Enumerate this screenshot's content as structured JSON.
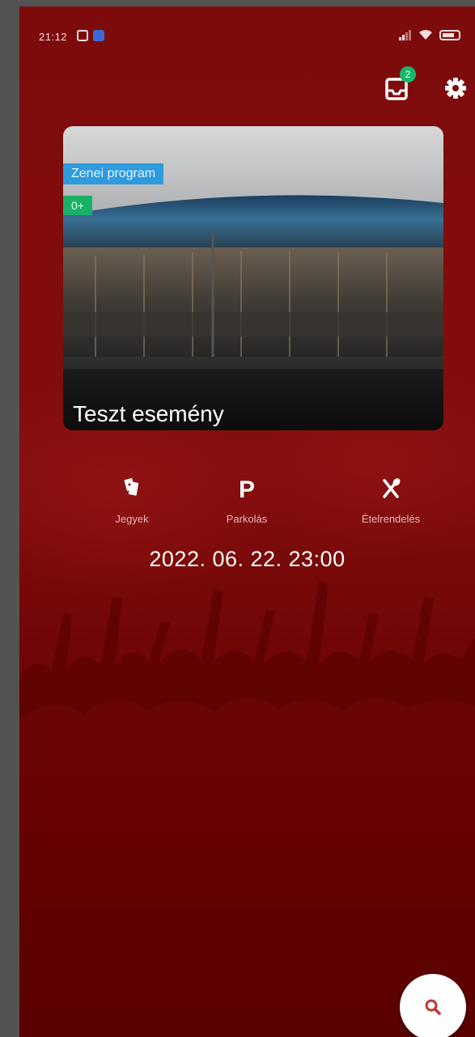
{
  "status_bar": {
    "time": "21:12",
    "icons": [
      "notification-icon",
      "app-icon",
      "signal-icon",
      "wifi-icon",
      "battery-icon"
    ]
  },
  "header": {
    "inbox_badge": "2",
    "inbox_icon": "inbox-icon",
    "settings_icon": "gear-icon"
  },
  "event_card": {
    "category": "Zenei program",
    "age_rating": "0+",
    "title": "Teszt esemény"
  },
  "quick_actions": [
    {
      "label": "Jegyek",
      "icon": "ticket-icon"
    },
    {
      "label": "Parkolás",
      "icon": "parking-icon"
    },
    {
      "label": "Ételrendelés",
      "icon": "food-icon"
    }
  ],
  "event_datetime": "2022. 06. 22. 23:00",
  "fab": {
    "icon": "search-icon"
  },
  "colors": {
    "background": "#7d0a0a",
    "category_tag": "#2e9bde",
    "age_tag": "#19b067",
    "badge": "#18b86a",
    "fab_icon": "#c0392b"
  }
}
